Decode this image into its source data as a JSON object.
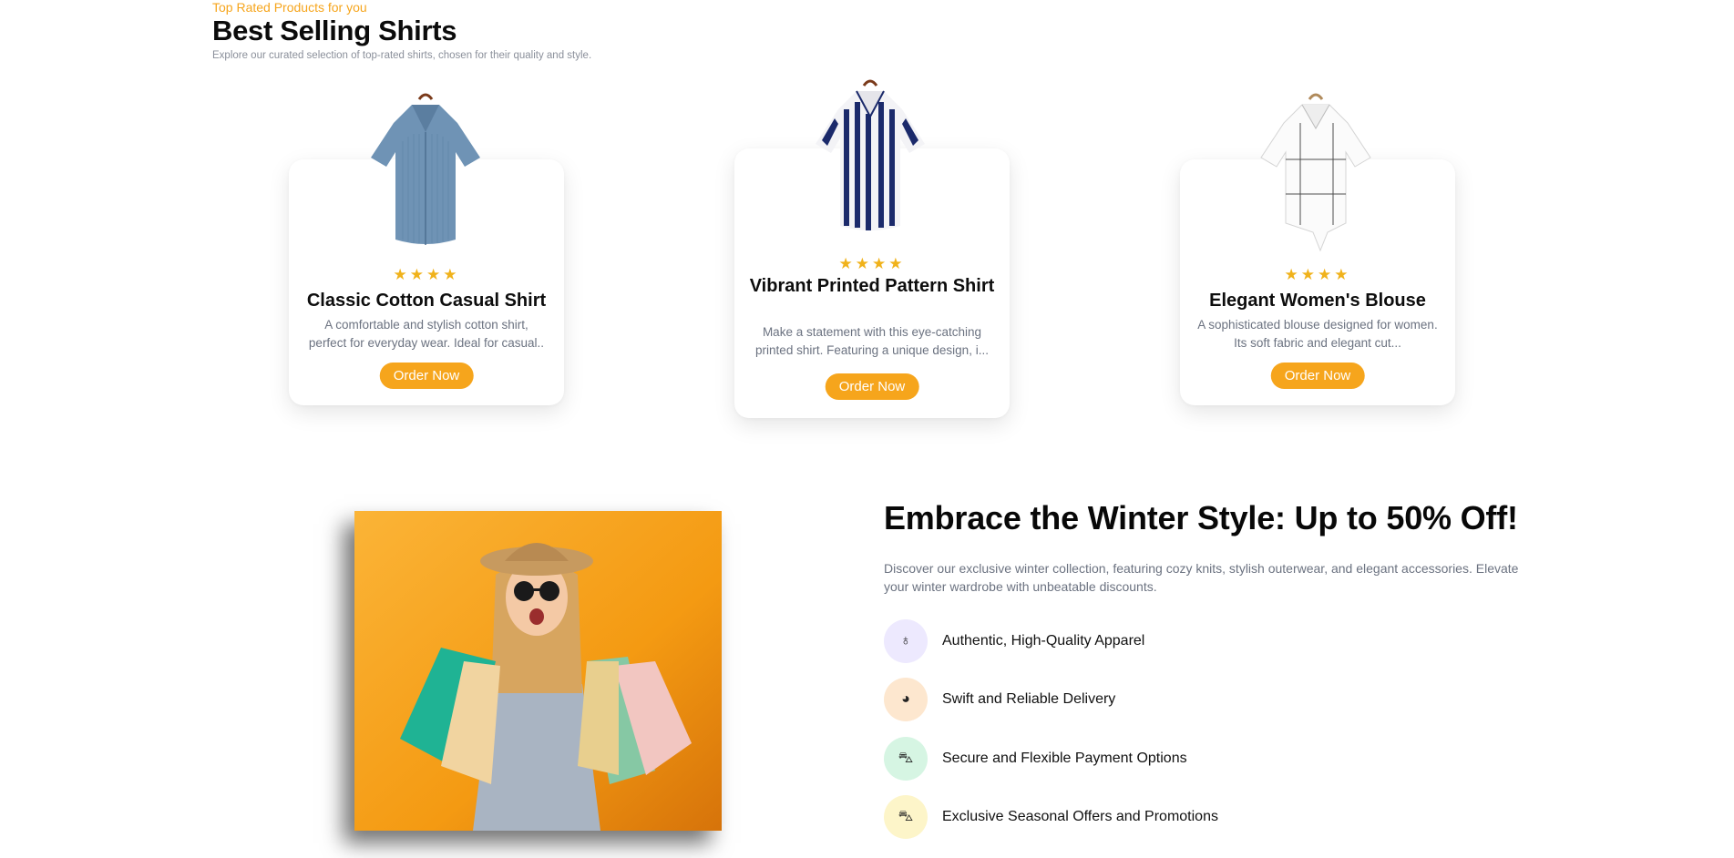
{
  "section": {
    "eyebrow": "Top Rated Products for you",
    "title": "Best Selling Shirts",
    "subtitle": "Explore our curated selection of top-rated shirts, chosen for their quality and style."
  },
  "products": [
    {
      "title": "Classic Cotton Casual Shirt",
      "description": "A comfortable and stylish cotton shirt, perfect for everyday wear. Ideal for casual..",
      "stars": "★★★★",
      "rating": 4,
      "button": "Order Now"
    },
    {
      "title": "Vibrant Printed Pattern Shirt",
      "description": "Make a statement with this eye-catching printed shirt. Featuring a unique design, i...",
      "stars": "★★★★",
      "rating": 4,
      "button": "Order Now"
    },
    {
      "title": "Elegant Women's Blouse",
      "description": "A sophisticated blouse designed for women. Its soft fabric and elegant cut...",
      "stars": "★★★★",
      "rating": 4,
      "button": "Order Now"
    }
  ],
  "promo": {
    "heading": "Embrace the Winter Style: Up to 50% Off!",
    "text": "Discover our exclusive winter collection, featuring cozy knits, stylish outerwear, and elegant accessories. Elevate your winter wardrobe with unbeatable discounts.",
    "features": [
      {
        "label": "Authentic, High-Quality Apparel",
        "icon": "badge-icon",
        "glyph": "♁",
        "bg": "#ede9fe"
      },
      {
        "label": "Swift and Reliable Delivery",
        "icon": "delivery-icon",
        "glyph": "◕",
        "bg": "#fde7cf"
      },
      {
        "label": "Secure and Flexible Payment Options",
        "icon": "payment-icon",
        "glyph": "⛍",
        "bg": "#d6f5e3"
      },
      {
        "label": "Exclusive Seasonal Offers and Promotions",
        "icon": "offer-icon",
        "glyph": "⛍",
        "bg": "#fdf5c9"
      }
    ]
  },
  "colors": {
    "accent": "#f6a51c",
    "star": "#f0b21b",
    "muted_text": "#6b7280"
  }
}
